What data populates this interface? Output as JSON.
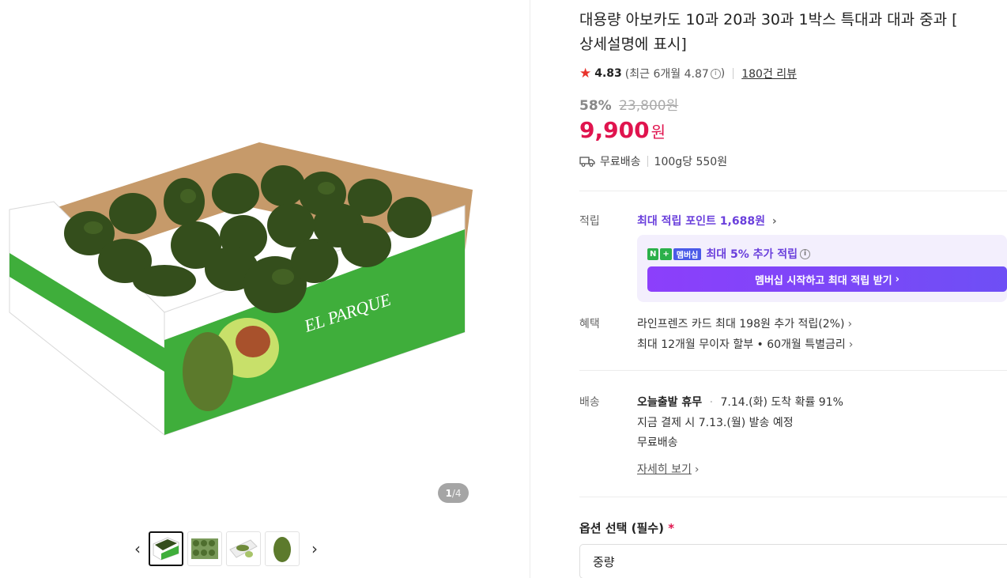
{
  "gallery": {
    "counter_current": "1",
    "counter_total": "4",
    "prev_icon": "chevron-left-icon",
    "next_icon": "chevron-right-icon"
  },
  "product": {
    "title_line1": "대용량 아보카도 10과 20과 30과 1박스 특대과 대과 중과 [",
    "title_line2": "상세설명에 표시]",
    "rating": "4.83",
    "rating_recent": "(최근 6개월 4.87",
    "rating_recent_close": ")",
    "review_count": "180건 리뷰",
    "discount_rate": "58%",
    "original_price": "23,800원",
    "price": "9,900",
    "price_unit": "원",
    "shipping": "무료배송",
    "unit_price": "100g당 550원"
  },
  "points": {
    "label": "적립",
    "max_points_text": "최대 적립 포인트",
    "max_points_value": "1,688원",
    "member_badge_n": "N",
    "member_badge_plus": "+",
    "member_badge_label": "멤버십",
    "member_extra": "최대 5% 추가 적립",
    "member_button": "멤버십 시작하고 최대 적립 받기"
  },
  "benefits": {
    "label": "혜택",
    "items": [
      "라인프렌즈 카드 최대 198원 추가 적립(2%)",
      "최대 12개월 무이자 할부 • 60개월 특별금리"
    ]
  },
  "delivery": {
    "label": "배송",
    "today": "오늘출발 휴무",
    "arrival": "7.14.(화) 도착 확률 91%",
    "dispatch": "지금 결제 시 7.13.(월) 발송 예정",
    "free": "무료배송",
    "detail_link": "자세히 보기"
  },
  "option": {
    "title": "옵션 선택 (필수)",
    "required_mark": "*",
    "selected": "중량"
  },
  "colors": {
    "price": "#e0144e",
    "accent_purple": "#6a3fdc",
    "star": "#e8322b"
  }
}
